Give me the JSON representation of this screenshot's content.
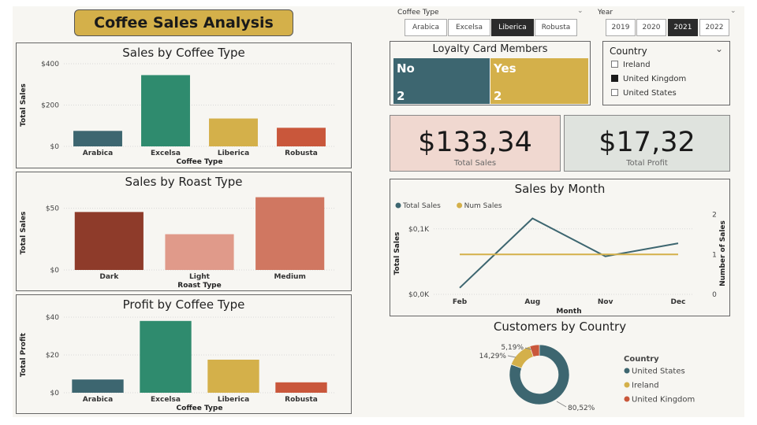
{
  "title": "Coffee Sales Analysis",
  "colors": {
    "teal": "#3d6670",
    "green": "#2f8b6e",
    "gold": "#d4b04a",
    "orange": "#c9573b",
    "dark_roast": "#8e3b2a",
    "light_roast": "#e09a8a",
    "medium_roast": "#d07761",
    "kpi_sales_bg": "#f0d8d0",
    "kpi_profit_bg": "#dfe3de"
  },
  "coffee_type_slicer": {
    "label": "Coffee Type",
    "options": [
      "Arabica",
      "Excelsa",
      "Liberica",
      "Robusta"
    ],
    "selected": "Liberica"
  },
  "year_slicer": {
    "label": "Year",
    "options": [
      "2019",
      "2020",
      "2021",
      "2022"
    ],
    "selected": "2021"
  },
  "loyalty": {
    "title": "Loyalty Card Members",
    "no_label": "No",
    "no_value": "2",
    "yes_label": "Yes",
    "yes_value": "2"
  },
  "country_slicer": {
    "title": "Country",
    "items": [
      {
        "label": "Ireland",
        "checked": false
      },
      {
        "label": "United Kingdom",
        "checked": true
      },
      {
        "label": "United States",
        "checked": false
      }
    ]
  },
  "kpis": {
    "sales_value": "$133,34",
    "sales_label": "Total Sales",
    "profit_value": "$17,32",
    "profit_label": "Total Profit"
  },
  "chart_data": [
    {
      "type": "bar",
      "title": "Sales by Coffee Type",
      "xlabel": "Coffee Type",
      "ylabel": "Total Sales",
      "categories": [
        "Arabica",
        "Excelsa",
        "Liberica",
        "Robusta"
      ],
      "values": [
        75,
        345,
        135,
        90
      ],
      "ylim": [
        0,
        400
      ],
      "yticks": [
        "$0",
        "$200",
        "$400"
      ],
      "ytick_values": [
        0,
        200,
        400
      ],
      "bar_colors": [
        "#3d6670",
        "#2f8b6e",
        "#d4b04a",
        "#c9573b"
      ]
    },
    {
      "type": "bar",
      "title": "Sales by Roast Type",
      "xlabel": "Roast Type",
      "ylabel": "Total Sales",
      "categories": [
        "Dark",
        "Light",
        "Medium"
      ],
      "values": [
        47,
        29,
        59
      ],
      "ylim": [
        0,
        60
      ],
      "yticks": [
        "$0",
        "$50"
      ],
      "ytick_values": [
        0,
        50
      ],
      "bar_colors": [
        "#8e3b2a",
        "#e09a8a",
        "#d07761"
      ]
    },
    {
      "type": "bar",
      "title": "Profit by Coffee Type",
      "xlabel": "Coffee Type",
      "ylabel": "Total Profit",
      "categories": [
        "Arabica",
        "Excelsa",
        "Liberica",
        "Robusta"
      ],
      "values": [
        7,
        38,
        17.5,
        5.5
      ],
      "ylim": [
        0,
        40
      ],
      "yticks": [
        "$0",
        "$20",
        "$40"
      ],
      "ytick_values": [
        0,
        20,
        40
      ],
      "bar_colors": [
        "#3d6670",
        "#2f8b6e",
        "#d4b04a",
        "#c9573b"
      ]
    },
    {
      "type": "line",
      "title": "Sales by Month",
      "xlabel": "Month",
      "ylabel": "Total Sales",
      "y2label": "Number of Sales",
      "categories": [
        "Feb",
        "Aug",
        "Nov",
        "Dec"
      ],
      "series": [
        {
          "name": "Total Sales",
          "values": [
            100,
            1160,
            580,
            780
          ],
          "color": "#3d6670"
        },
        {
          "name": "Num Sales",
          "values": [
            1,
            1,
            1,
            1
          ],
          "color": "#d4b04a",
          "axis": "right"
        }
      ],
      "ylim": [
        0,
        1250
      ],
      "yticks": [
        "$0,0K",
        "$0,1K"
      ],
      "ytick_values": [
        0,
        1000
      ],
      "y2lim": [
        0,
        2.05
      ],
      "y2ticks": [
        "0",
        "1",
        "2"
      ],
      "y2tick_values": [
        0,
        1,
        2
      ]
    },
    {
      "type": "pie",
      "title": "Customers by Country",
      "legend_title": "Country",
      "categories": [
        "United States",
        "Ireland",
        "United Kingdom"
      ],
      "values": [
        80.52,
        14.29,
        5.19
      ],
      "labels": [
        "80,52%",
        "14,29%",
        "5,19%"
      ],
      "colors": [
        "#3d6670",
        "#d4b04a",
        "#c9573b"
      ]
    }
  ]
}
